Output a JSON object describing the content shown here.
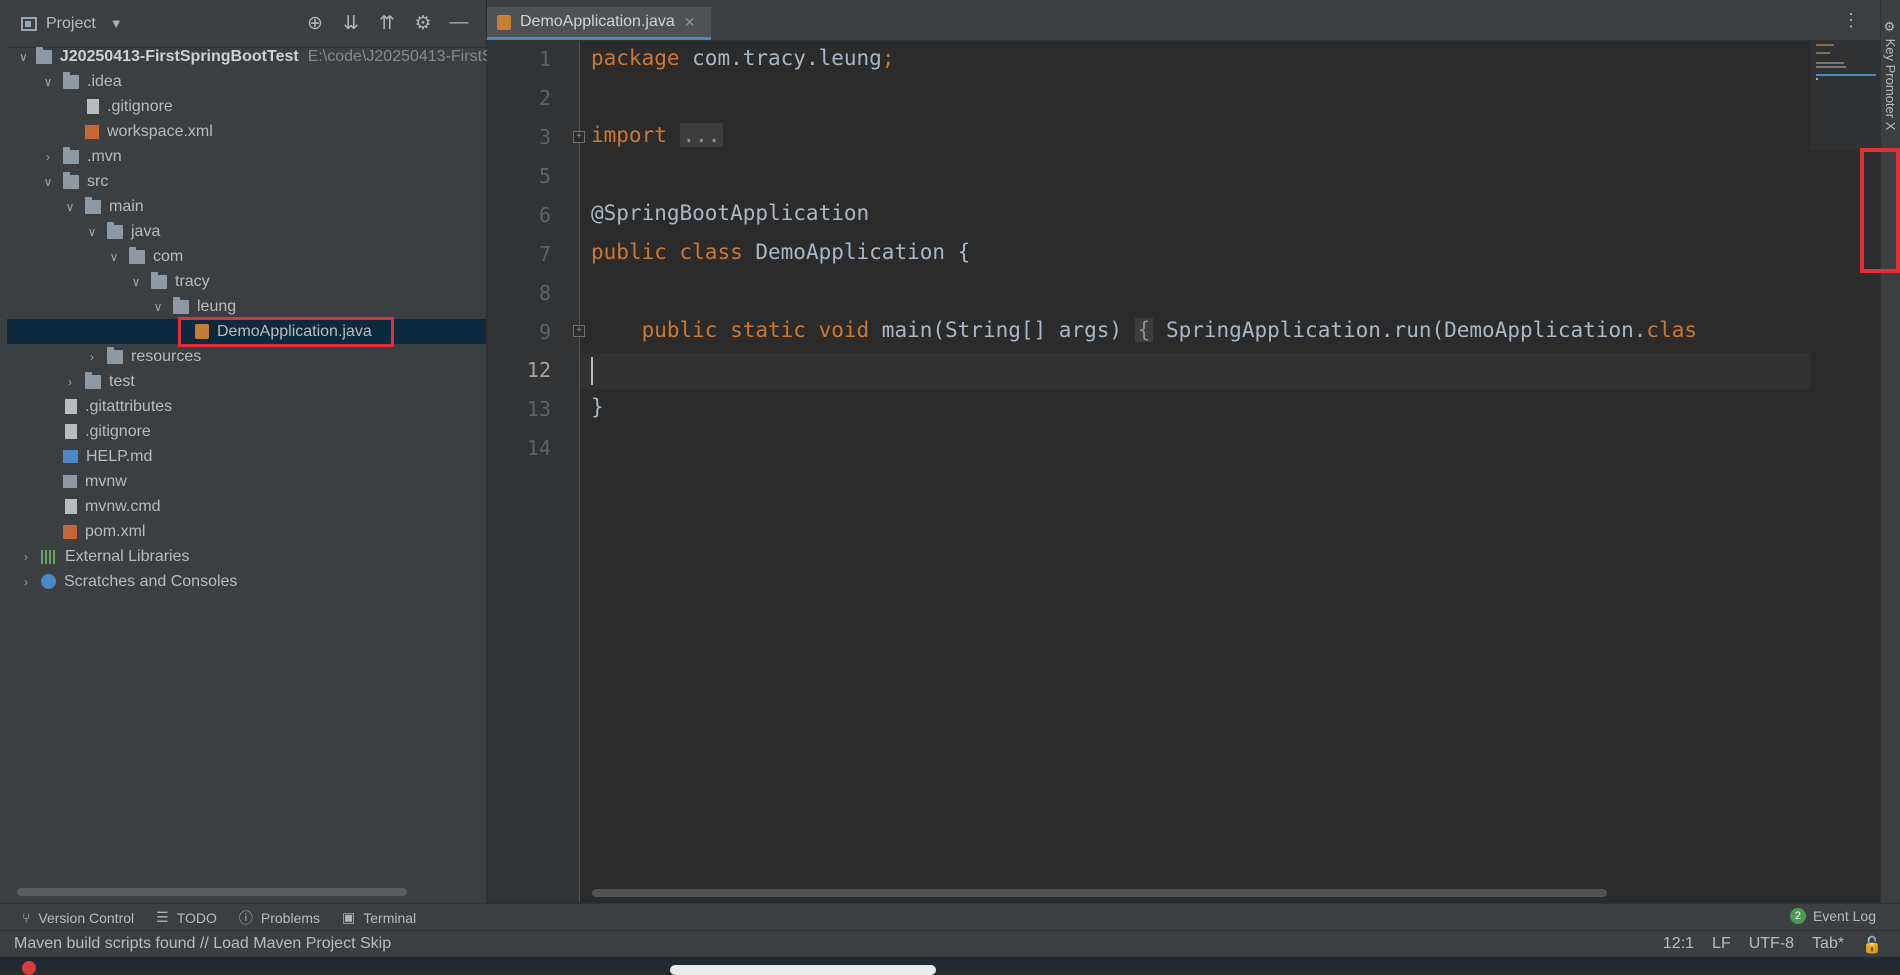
{
  "project_panel": {
    "title": "Project",
    "tools": [
      "target-icon",
      "expand-all-icon",
      "collapse-all-icon",
      "gear-icon",
      "minimize-icon"
    ],
    "tree": [
      {
        "label": "J20250413-FirstSpringBootTest",
        "sub": "E:\\code\\J20250413-FirstS|",
        "depth": 0,
        "arrow": "down",
        "icon": "module",
        "bold": true
      },
      {
        "label": ".idea",
        "depth": 1,
        "arrow": "down",
        "icon": "folder"
      },
      {
        "label": ".gitignore",
        "depth": 2,
        "arrow": "none",
        "icon": "file"
      },
      {
        "label": "workspace.xml",
        "depth": 2,
        "arrow": "none",
        "icon": "xml"
      },
      {
        "label": ".mvn",
        "depth": 1,
        "arrow": "right",
        "icon": "folder"
      },
      {
        "label": "src",
        "depth": 1,
        "arrow": "down",
        "icon": "folder"
      },
      {
        "label": "main",
        "depth": 2,
        "arrow": "down",
        "icon": "folder"
      },
      {
        "label": "java",
        "depth": 3,
        "arrow": "down",
        "icon": "folder"
      },
      {
        "label": "com",
        "depth": 4,
        "arrow": "down",
        "icon": "folder"
      },
      {
        "label": "tracy",
        "depth": 5,
        "arrow": "down",
        "icon": "folder"
      },
      {
        "label": "leung",
        "depth": 6,
        "arrow": "down",
        "icon": "folder"
      },
      {
        "label": "DemoApplication.java",
        "depth": 7,
        "arrow": "none",
        "icon": "java",
        "selected": true
      },
      {
        "label": "resources",
        "depth": 3,
        "arrow": "right",
        "icon": "folder"
      },
      {
        "label": "test",
        "depth": 2,
        "arrow": "right",
        "icon": "folder"
      },
      {
        "label": ".gitattributes",
        "depth": 1,
        "arrow": "none",
        "icon": "file"
      },
      {
        "label": ".gitignore",
        "depth": 1,
        "arrow": "none",
        "icon": "file"
      },
      {
        "label": "HELP.md",
        "depth": 1,
        "arrow": "none",
        "icon": "md"
      },
      {
        "label": "mvnw",
        "depth": 1,
        "arrow": "none",
        "icon": "term"
      },
      {
        "label": "mvnw.cmd",
        "depth": 1,
        "arrow": "none",
        "icon": "file"
      },
      {
        "label": "pom.xml",
        "depth": 1,
        "arrow": "none",
        "icon": "xml"
      },
      {
        "label": "External Libraries",
        "depth": 0,
        "arrow": "right",
        "icon": "lib"
      },
      {
        "label": "Scratches and Consoles",
        "depth": 0,
        "arrow": "right",
        "icon": "scratch"
      }
    ]
  },
  "editor": {
    "tab_label": "DemoApplication.java",
    "line_numbers": [
      "1",
      "2",
      "3",
      "5",
      "6",
      "7",
      "8",
      "9",
      "12",
      "13",
      "14"
    ],
    "current_line": "12"
  },
  "code_lines": {
    "l1_kw": "package",
    "l1_rest": " com.tracy.leung",
    "l1_semi": ";",
    "l3_kw": "import",
    "l3_fold": "...",
    "l6": "@SpringBootApplication",
    "l7_kw1": "public",
    "l7_kw2": "class",
    "l7_rest": " DemoApplication {",
    "l9_kw": "public static void",
    "l9_mid": " main(String[] args) ",
    "l9_brace": "{",
    "l9_call": " SpringApplication.run(DemoApplication.",
    "l9_tail": "clas",
    "l13": "}"
  },
  "right_strip": {
    "label": "Key Promoter X"
  },
  "bottom_tools": {
    "version_control": "Version Control",
    "todo": "TODO",
    "problems": "Problems",
    "terminal": "Terminal",
    "event_log": "Event Log",
    "event_count": "2"
  },
  "status": {
    "message": "Maven build scripts found // Load Maven Project   Skip",
    "position": "12:1",
    "line_sep": "LF",
    "encoding": "UTF-8",
    "indent": "Tab*"
  }
}
